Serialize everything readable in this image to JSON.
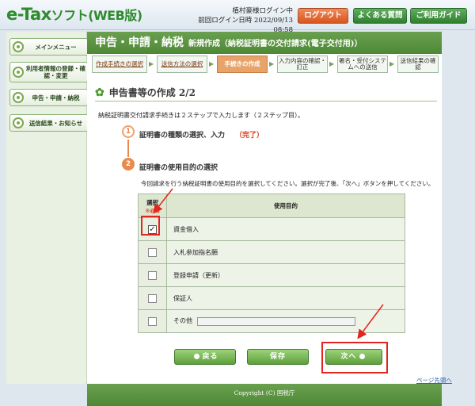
{
  "header": {
    "logo_main": "e-Tax",
    "logo_sub": "ソフト(WEB版)",
    "user_name": "植村豪様ログイン中",
    "last_login_label": "前回ログイン日時",
    "last_login_time": "2022/09/13 08:58",
    "logout_label": "ログアウト",
    "faq_label": "よくある質問",
    "guide_label": "ご利用ガイド"
  },
  "sidebar": {
    "items": [
      {
        "label": "メインメニュー"
      },
      {
        "label": "利用者情報の登録・確認・変更"
      },
      {
        "label": "申告・申請・納税"
      },
      {
        "label": "送信結果・お知らせ"
      }
    ]
  },
  "main": {
    "title": "申告・申請・納税",
    "subtitle": "新規作成（納税証明書の交付請求(電子交付用)）",
    "steps": [
      {
        "label": "作成手続きの選択"
      },
      {
        "label": "送信方法の選択"
      },
      {
        "label": "手続きの作成"
      },
      {
        "label": "入力内容の確認・訂正"
      },
      {
        "label": "署名・受付システムへの送信"
      },
      {
        "label": "送信結果の確認"
      }
    ],
    "section_title": "申告書等の作成 2/2",
    "intro": "納税証明書交付請求手続きは２ステップで入力します（２ステップ目）。",
    "step1": {
      "number": "1",
      "label": "証明書の種類の選択、入力",
      "status": "（完了）"
    },
    "step2": {
      "number": "2",
      "label": "証明書の使用目的の選択"
    },
    "instruction": "今回請求を行う納税証明書の使用目的を選択してください。選択が完了後、「次へ」ボタンを押してください。"
  },
  "table": {
    "col_select": "選択",
    "col_required": "※必須",
    "col_purpose": "使用目的",
    "rows": [
      {
        "label": "資金借入",
        "checked": true
      },
      {
        "label": "入札参加指名願",
        "checked": false
      },
      {
        "label": "登録申請（更新）",
        "checked": false
      },
      {
        "label": "保証人",
        "checked": false
      },
      {
        "label": "その他",
        "checked": false
      }
    ]
  },
  "buttons": {
    "back": "戻る",
    "save": "保存",
    "next": "次へ"
  },
  "pagetop": "ページ先頭へ",
  "footer": "Copyright (C) 国税庁",
  "colors": {
    "brand_green": "#4e8835",
    "accent_orange": "#e98a4c",
    "annotation_red": "#e2251d"
  }
}
